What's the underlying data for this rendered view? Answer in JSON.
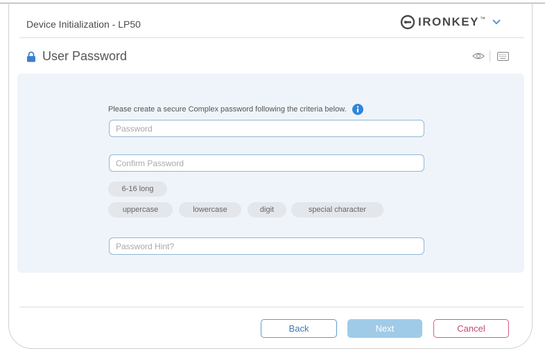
{
  "window": {
    "title": "Device Initialization - LP50"
  },
  "brand": {
    "name": "IRONKEY",
    "tm": "™"
  },
  "section": {
    "title": "User Password"
  },
  "form": {
    "instruction": "Please create a secure Complex password following the criteria below.",
    "password_placeholder": "Password",
    "password_value": "",
    "confirm_placeholder": "Confirm Password",
    "confirm_value": "",
    "hint_placeholder": "Password Hint?",
    "hint_value": ""
  },
  "criteria": {
    "length": "6-16 long",
    "items": [
      "uppercase",
      "lowercase",
      "digit",
      "special character"
    ]
  },
  "buttons": {
    "back": "Back",
    "next": "Next",
    "cancel": "Cancel"
  },
  "colors": {
    "accent": "#2f86d8",
    "field_border": "#90b7d6",
    "panel_bg": "#eff4fa",
    "next_disabled": "#9fcbe9",
    "cancel": "#d35c87"
  },
  "icons": {
    "lock": "lock-icon",
    "brand": "ironkey-logo-icon",
    "dropdown": "chevron-down-icon",
    "show_password": "eye-icon",
    "keyboard": "keyboard-icon",
    "info": "info-icon"
  }
}
